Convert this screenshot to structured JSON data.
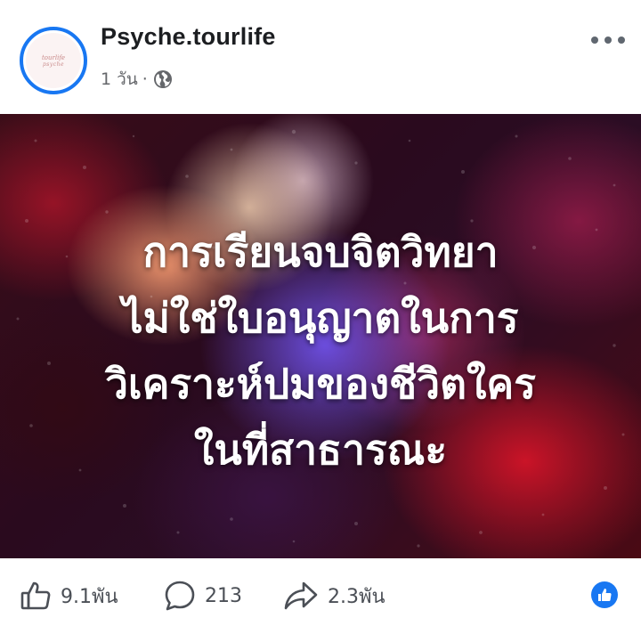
{
  "post": {
    "page_name": "Psyche.tourlife",
    "timestamp": "1 วัน",
    "separator": "·",
    "privacy_icon": "globe-icon",
    "avatar_logo_text": [
      "tourlife",
      "psyche"
    ],
    "more_icon": "more-dots-icon"
  },
  "image": {
    "text_lines": [
      "การเรียนจบจิตวิทยา",
      "ไม่ใช่ใบอนุญาตในการ",
      "วิเคราะห์ปมของชีวิตใคร",
      "ในที่สาธารณะ"
    ]
  },
  "actions": {
    "like": {
      "icon": "thumbs-up-icon",
      "count": "9.1พัน"
    },
    "comment": {
      "icon": "comment-bubble-icon",
      "count": "213"
    },
    "share": {
      "icon": "share-arrow-icon",
      "count": "2.3พัน"
    },
    "reaction_icon": "like-reaction-icon"
  },
  "colors": {
    "accent": "#1877f2",
    "icon_gray": "#4b4f56",
    "meta_gray": "#65676b"
  }
}
